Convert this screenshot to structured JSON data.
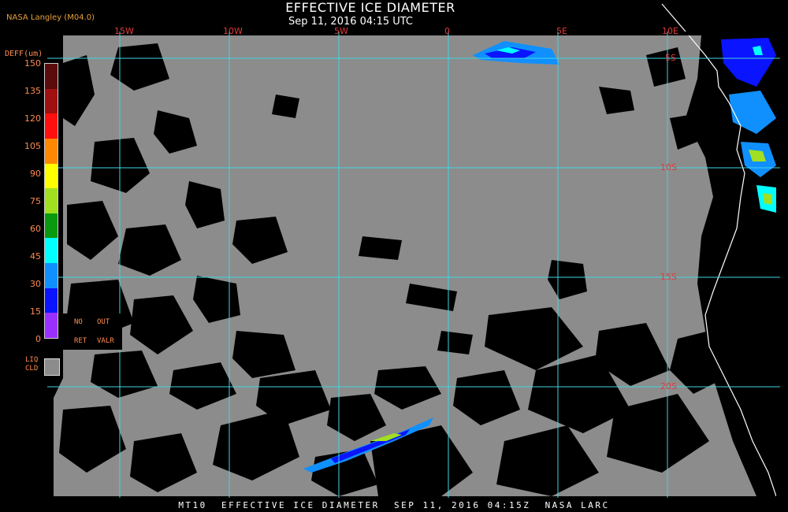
{
  "header": {
    "title": "EFFECTIVE ICE DIAMETER",
    "subtitle": "Sep 11, 2016 04:15 UTC",
    "brand": "NASA Langley (M04.0)"
  },
  "legend": {
    "title": "DEFF(um)",
    "tick_labels": [
      "150",
      "135",
      "120",
      "105",
      "90",
      "75",
      "60",
      "45",
      "30",
      "15",
      "0"
    ],
    "colors": [
      "#5a0b0b",
      "#a01010",
      "#ff1010",
      "#ff8800",
      "#ffff00",
      "#a0e020",
      "#0a9a10",
      "#00ffff",
      "#1090ff",
      "#0a14ff",
      "#9a30ff"
    ],
    "no_ret": {
      "line1_a": "NO",
      "line1_b": "OUT",
      "line2_a": "RET",
      "line2_b": "VALR"
    },
    "liquid": {
      "line1": "LIQ",
      "line2": "CLD",
      "color": "#8c8c8c"
    }
  },
  "map": {
    "longitude_labels": [
      "15W",
      "10W",
      "5W",
      "0",
      "5E",
      "10E"
    ],
    "latitude_labels": [
      "5S",
      "10S",
      "15S",
      "20S"
    ],
    "grid_color": "#3fd6e0",
    "liquid_cloud_color": "#8c8c8c",
    "clear_color": "#000000",
    "coast_color": "#ffffff"
  },
  "footer": {
    "text": "MT10  EFFECTIVE ICE DIAMETER  SEP 11, 2016 04:15Z  NASA LARC"
  }
}
